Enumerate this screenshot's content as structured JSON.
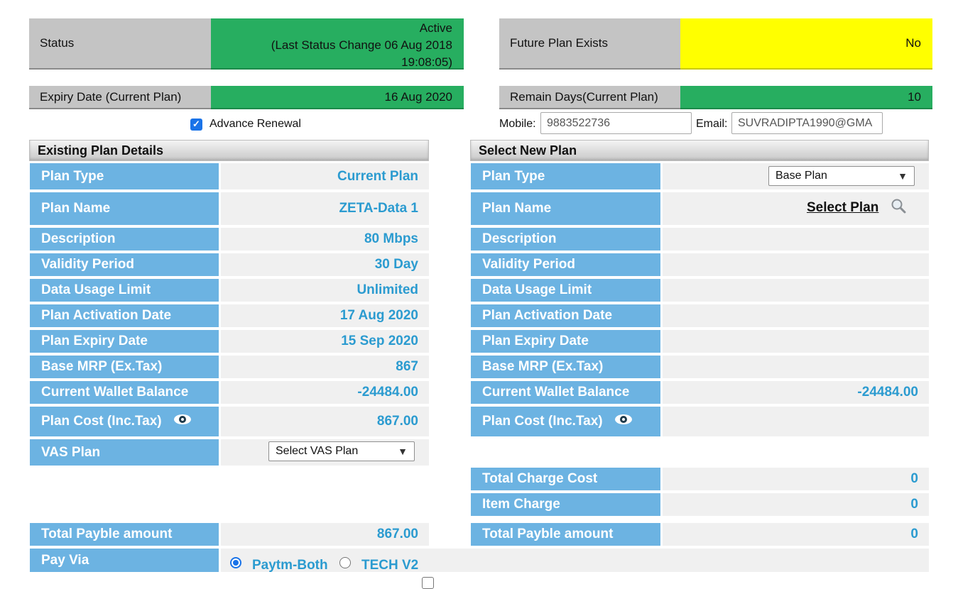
{
  "status": {
    "label": "Status",
    "value_line1": "Active",
    "value_line2": "(Last Status Change 06 Aug 2018",
    "value_line3": "19:08:05)",
    "future_label": "Future Plan Exists",
    "future_value": "No"
  },
  "expiry": {
    "label": "Expiry Date (Current Plan)",
    "value": "16 Aug 2020",
    "remain_label": "Remain Days(Current Plan)",
    "remain_value": "10"
  },
  "advance_renewal": {
    "label": "Advance Renewal",
    "checked": true
  },
  "contact": {
    "mobile_label": "Mobile:",
    "mobile_value": "9883522736",
    "email_label": "Email:",
    "email_value": "SUVRADIPTA1990@GMA"
  },
  "existing": {
    "header": "Existing Plan Details",
    "rows": [
      {
        "label": "Plan Type",
        "value": "Current Plan"
      },
      {
        "label": "Plan Name",
        "value": "ZETA-Data 1"
      },
      {
        "label": "Description",
        "value": "80 Mbps"
      },
      {
        "label": "Validity Period",
        "value": "30 Day"
      },
      {
        "label": "Data Usage Limit",
        "value": "Unlimited"
      },
      {
        "label": "Plan Activation Date",
        "value": "17 Aug 2020"
      },
      {
        "label": "Plan Expiry Date",
        "value": "15 Sep 2020"
      },
      {
        "label": "Base MRP (Ex.Tax)",
        "value": "867"
      },
      {
        "label": "Current Wallet Balance",
        "value": "-24484.00"
      },
      {
        "label": "Plan Cost (Inc.Tax)",
        "value": "867.00"
      },
      {
        "label": "VAS Plan",
        "value": "Select VAS Plan"
      }
    ],
    "total_label": "Total Payble amount",
    "total_value": "867.00",
    "payvia_label": "Pay Via",
    "payvia_options": [
      "Paytm-Both",
      "TECH V2"
    ]
  },
  "newplan": {
    "header": "Select New Plan",
    "rows": [
      {
        "label": "Plan Type",
        "value": "Base Plan"
      },
      {
        "label": "Plan Name",
        "value": "Select Plan"
      },
      {
        "label": "Description",
        "value": ""
      },
      {
        "label": "Validity Period",
        "value": ""
      },
      {
        "label": "Data Usage Limit",
        "value": ""
      },
      {
        "label": "Plan Activation Date",
        "value": ""
      },
      {
        "label": "Plan Expiry Date",
        "value": ""
      },
      {
        "label": "Base MRP (Ex.Tax)",
        "value": ""
      },
      {
        "label": "Current Wallet Balance",
        "value": "-24484.00"
      },
      {
        "label": "Plan Cost (Inc.Tax)",
        "value": ""
      }
    ],
    "total_charge_label": "Total Charge Cost",
    "total_charge_value": "0",
    "item_charge_label": "Item Charge",
    "item_charge_value": "0",
    "total_label": "Total Payble amount",
    "total_value": "0"
  },
  "icons": {
    "eye": "eye-icon",
    "search": "search-icon",
    "chevron": "chevron-down-icon"
  },
  "colors": {
    "label_bg": "#6cb3e2",
    "value_text": "#2b9bd0",
    "status_green": "#27ae60",
    "future_yellow": "#ffff00"
  }
}
